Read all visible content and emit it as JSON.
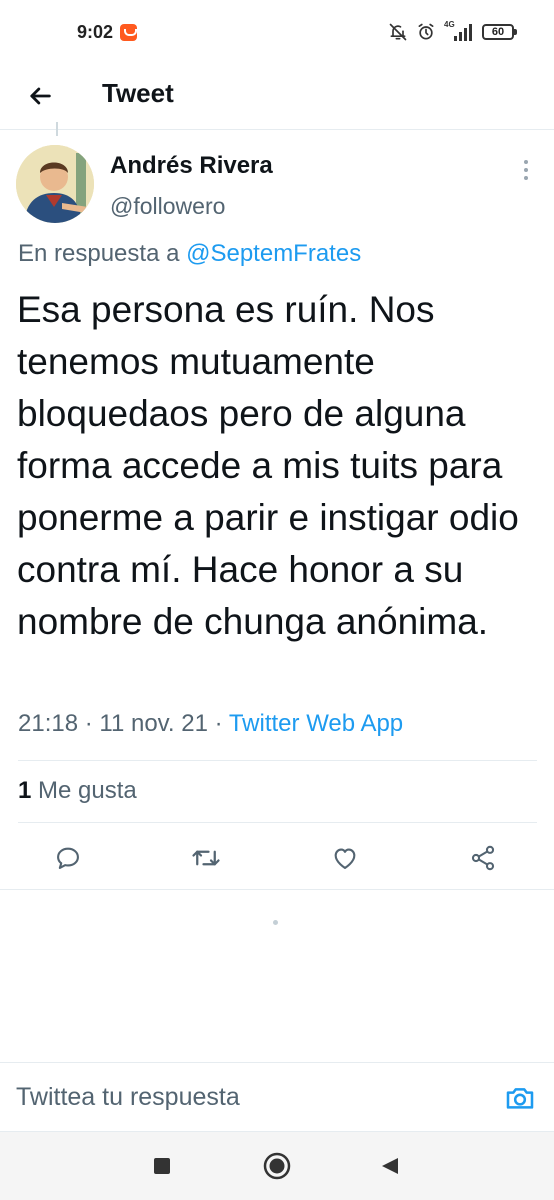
{
  "status_bar": {
    "time": "9:02",
    "network_label": "4G",
    "battery_level": "60",
    "icons": [
      "app-notification-icon",
      "mute-icon",
      "alarm-icon",
      "signal-icon",
      "battery-icon"
    ]
  },
  "header": {
    "title": "Tweet",
    "back_icon": "arrow-left-icon"
  },
  "tweet": {
    "author_name": "Andrés Rivera",
    "author_handle": "@followero",
    "reply_prefix": "En respuesta a",
    "reply_to": "@SeptemFrates",
    "text": "Esa persona es ruín. Nos tenemos mutuamente bloquedaos pero de alguna forma accede a mis tuits para ponerme a parir e instigar odio contra mí. Hace honor a su nombre de chunga anónima.",
    "time": "21:18",
    "separator": "·",
    "date": "11 nov. 21",
    "source": "Twitter Web App",
    "likes_count": "1",
    "likes_label": "Me gusta"
  },
  "actions": {
    "icons": [
      "reply-icon",
      "retweet-icon",
      "like-icon",
      "share-icon"
    ]
  },
  "composer": {
    "placeholder": "Twittea tu respuesta",
    "value": "",
    "camera_icon": "camera-icon"
  },
  "colors": {
    "accent": "#1d9bf0",
    "text_primary": "#0f1419",
    "text_secondary": "#536471",
    "divider": "#e6ecf0"
  }
}
